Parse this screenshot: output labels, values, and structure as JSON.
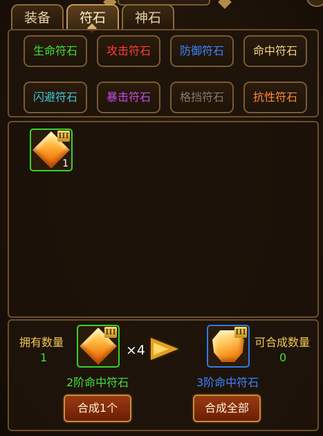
{
  "tabs": [
    {
      "label": "装备",
      "active": false
    },
    {
      "label": "符石",
      "active": true
    },
    {
      "label": "神石",
      "active": false
    }
  ],
  "categories": [
    {
      "label": "生命符石",
      "color": "#3ee03a"
    },
    {
      "label": "攻击符石",
      "color": "#ff3b3b"
    },
    {
      "label": "防御符石",
      "color": "#3a86ff"
    },
    {
      "label": "命中符石",
      "color": "#f2d18a"
    },
    {
      "label": "闪避符石",
      "color": "#3fc6d8"
    },
    {
      "label": "暴击符石",
      "color": "#c64be0"
    },
    {
      "label": "格挡符石",
      "color": "#8a7a6a"
    },
    {
      "label": "抗性符石",
      "color": "#ff8a3a"
    }
  ],
  "inventory": [
    {
      "tier": "III",
      "count": "1",
      "icon": "orange-rune-gem-icon"
    }
  ],
  "compose": {
    "owned_label": "拥有数量",
    "owned_value": "1",
    "source_tier": "III",
    "source_name": "2阶命中符石",
    "multiplier": "×4",
    "target_tier": "III",
    "target_name": "3阶命中符石",
    "composable_label": "可合成数量",
    "composable_value": "0",
    "compose_one_label": "合成1个",
    "compose_all_label": "合成全部"
  },
  "colors": {
    "label_gold": "#f0c850",
    "value_green": "#3ee03a",
    "source_name_green": "#3ee03a",
    "target_name_blue": "#3a86ff"
  }
}
